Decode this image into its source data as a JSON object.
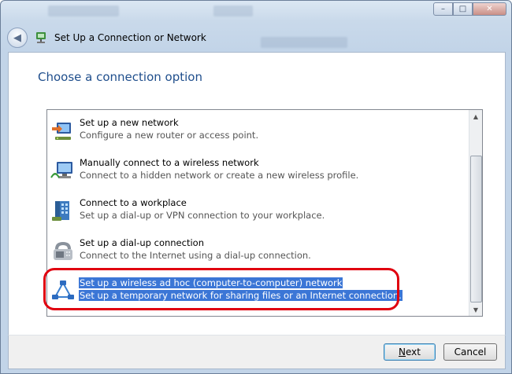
{
  "window": {
    "title": "Set Up a Connection or Network",
    "caption_buttons": {
      "minimize": "–",
      "maximize": "□",
      "close": "✕"
    }
  },
  "page": {
    "heading": "Choose a connection option"
  },
  "options": [
    {
      "title": "Set up a new network",
      "description": "Configure a new router or access point.",
      "icon": "new-network-icon",
      "selected": false
    },
    {
      "title": "Manually connect to a wireless network",
      "description": "Connect to a hidden network or create a new wireless profile.",
      "icon": "wireless-network-icon",
      "selected": false
    },
    {
      "title": "Connect to a workplace",
      "description": "Set up a dial-up or VPN connection to your workplace.",
      "icon": "workplace-icon",
      "selected": false
    },
    {
      "title": "Set up a dial-up connection",
      "description": "Connect to the Internet using a dial-up connection.",
      "icon": "dialup-phone-icon",
      "selected": false
    },
    {
      "title": "Set up a wireless ad hoc (computer-to-computer) network",
      "description": "Set up a temporary network for sharing files or an Internet connection.",
      "icon": "adhoc-network-icon",
      "selected": true
    }
  ],
  "buttons": {
    "next_prefix": "",
    "next_underlined": "N",
    "next_rest": "ext",
    "cancel": "Cancel"
  },
  "colors": {
    "heading": "#1f4e8c",
    "selection": "#3b76d6",
    "annotation_ring": "#e0000f"
  }
}
